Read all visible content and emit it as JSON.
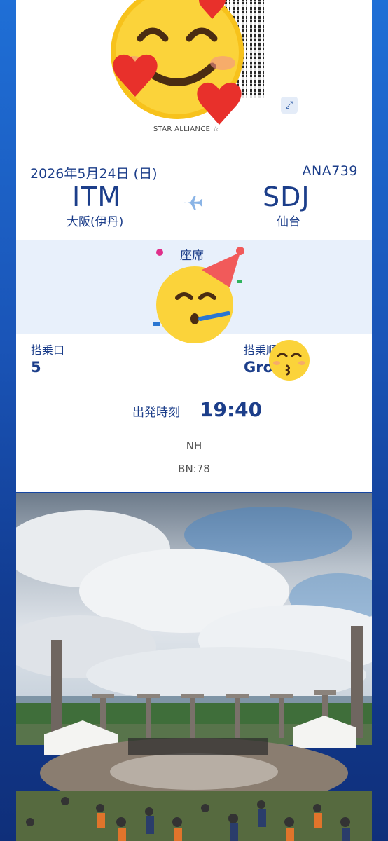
{
  "boarding_pass": {
    "alliance_text": "STAR ALLIANCE",
    "date": "2026年5月24日 (日)",
    "flight_number": "ANA739",
    "origin": {
      "code": "ITM",
      "city": "大阪(伊丹)"
    },
    "destination": {
      "code": "SDJ",
      "city": "仙台"
    },
    "seat_label": "座席",
    "gate": {
      "label": "搭乗口",
      "value": "5"
    },
    "group": {
      "label": "搭乗順",
      "value": "Gro"
    },
    "departure": {
      "label": "出発時刻",
      "time": "19:40"
    },
    "carrier_code": "NH",
    "boarding_number": "BN:78"
  },
  "icons": [
    "expand-icon",
    "airplane-icon",
    "star-icon"
  ],
  "stickers": [
    "smiling-face-with-hearts-emoji",
    "partying-face-emoji",
    "kissing-face-emoji"
  ],
  "colors": {
    "background_top": "#1f6fd6",
    "background_bottom": "#0f2f7a",
    "text_primary": "#1c3e8a",
    "seat_band": "#e8f0fb"
  }
}
